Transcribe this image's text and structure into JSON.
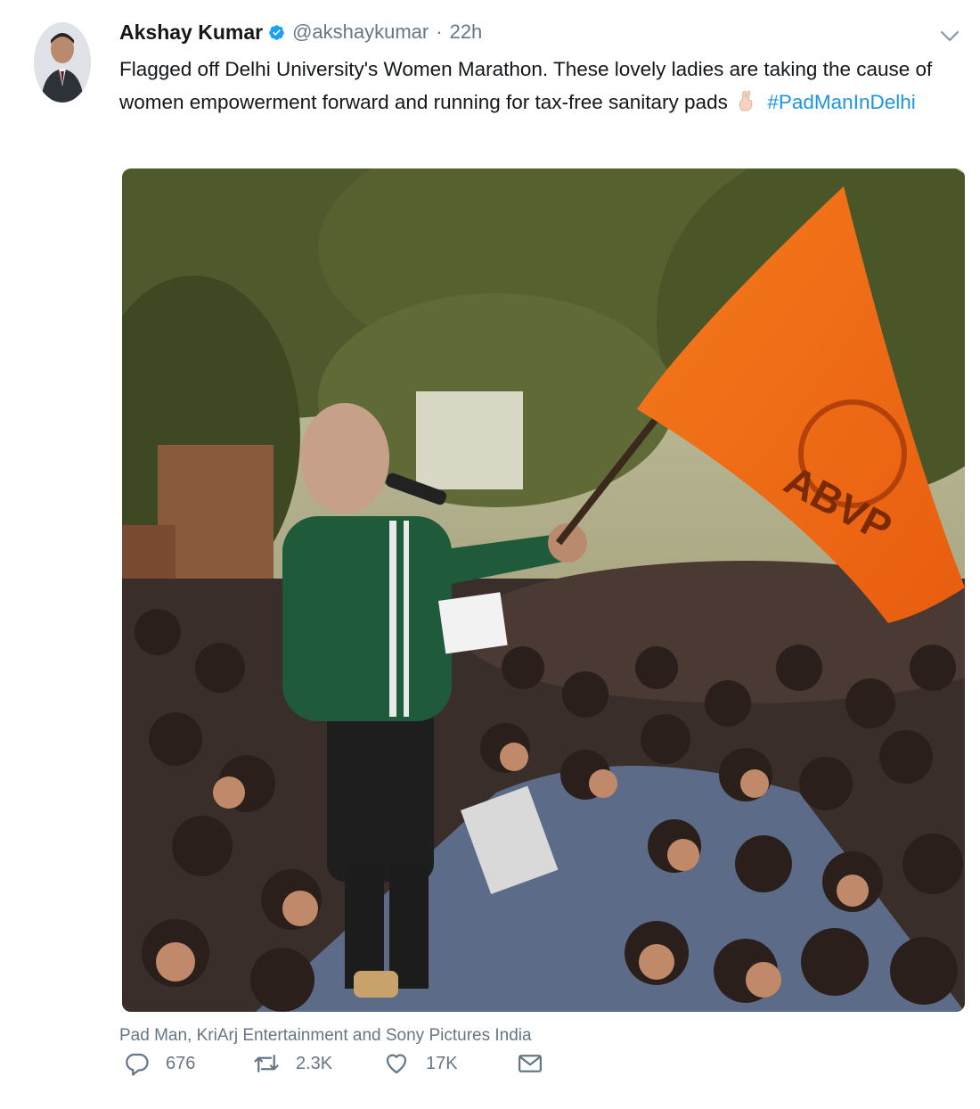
{
  "tweet": {
    "author_name": "Akshay Kumar",
    "handle": "@akshaykumar",
    "separator": "·",
    "time": "22h",
    "text_main": "Flagged off Delhi University's Women Marathon. These lovely ladies are taking the cause of women empowerment forward and running for tax-free sanitary pads",
    "hashtag": "#PadManInDelhi",
    "image_caption": "Pad Man, KriArj Entertainment and Sony Pictures India",
    "flag_text": "ABVP",
    "stats": {
      "replies": "676",
      "retweets": "2.3K",
      "likes": "17K"
    }
  },
  "colors": {
    "verified": "#1da1f2",
    "link": "#1b95e0",
    "muted": "#657786",
    "flag": "#f36b16"
  },
  "icons": {
    "verified": "verified-badge-icon",
    "caret": "chevron-down-icon",
    "reply": "reply-icon",
    "retweet": "retweet-icon",
    "like": "heart-icon",
    "dm": "envelope-icon"
  }
}
